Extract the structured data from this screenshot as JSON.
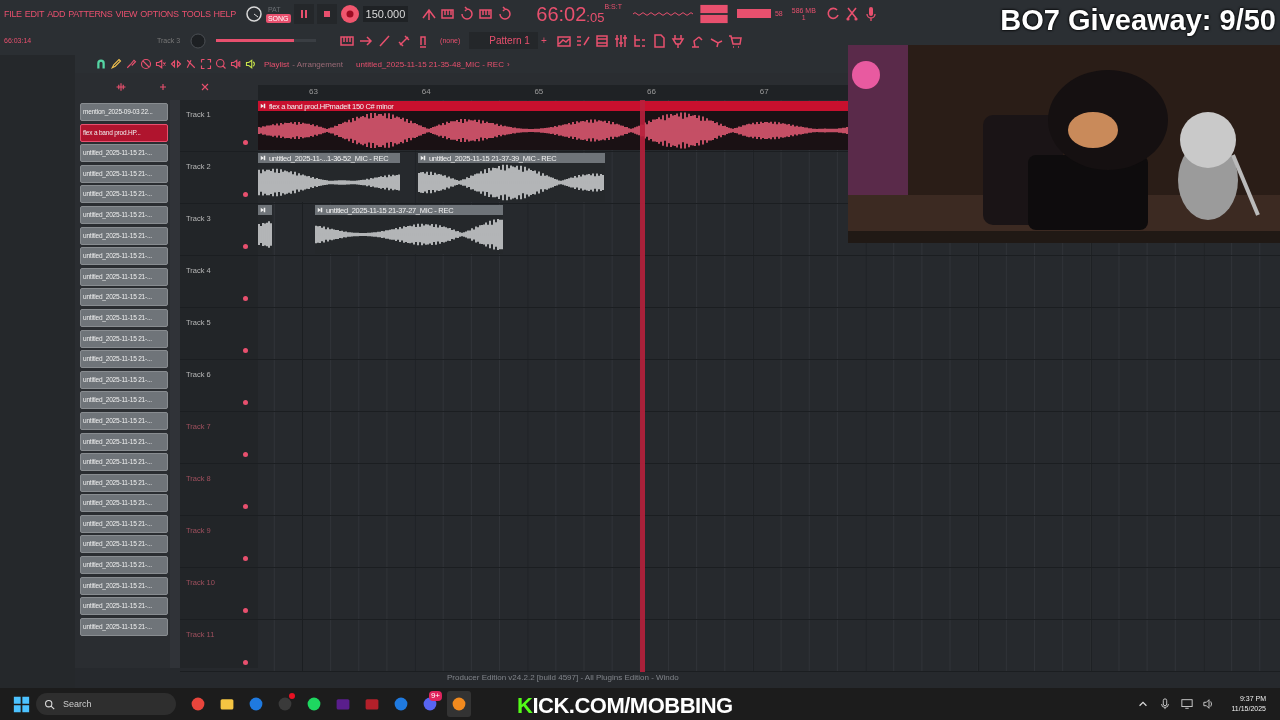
{
  "menu": [
    "FILE",
    "EDIT",
    "ADD",
    "PATTERNS",
    "VIEW",
    "OPTIONS",
    "TOOLS",
    "HELP"
  ],
  "transport": {
    "modes": [
      {
        "label": "PAT",
        "selected": false
      },
      {
        "label": "SONG",
        "selected": true
      }
    ],
    "record_on": true,
    "tempo": "150.000"
  },
  "time": {
    "main": "66:02",
    "sub": ":05",
    "unit": "B:S:T"
  },
  "monitor": {
    "cpu": "58",
    "memory": "586 MB",
    "polyphony": "1"
  },
  "hint_bar": {
    "position": "66:03:14",
    "target": "Track 3"
  },
  "main_volume": {
    "level": 0.78
  },
  "pattern": {
    "channel_filter": "(none)",
    "name": "Pattern 1",
    "add": "+"
  },
  "playlist": {
    "title": "Playlist",
    "view": "- Arrangement",
    "clip_name": "untitled_2025-11-15 21-35-48_MIC - REC",
    "arrow": "›"
  },
  "ruler": {
    "bars": [
      "63",
      "64",
      "65",
      "66",
      "67"
    ]
  },
  "clip_list": [
    {
      "name": "mention_2025-09-03 22...",
      "selected": false
    },
    {
      "name": "flex a band prod.HP...",
      "selected": true
    },
    {
      "name": "untitled_2025-11-15 21-...",
      "selected": false
    },
    {
      "name": "untitled_2025-11-15 21-...",
      "selected": false
    },
    {
      "name": "untitled_2025-11-15 21-...",
      "selected": false
    },
    {
      "name": "untitled_2025-11-15 21-...",
      "selected": false
    },
    {
      "name": "untitled_2025-11-15 21-...",
      "selected": false
    },
    {
      "name": "untitled_2025-11-15 21-...",
      "selected": false
    },
    {
      "name": "untitled_2025-11-15 21-...",
      "selected": false
    },
    {
      "name": "untitled_2025-11-15 21-...",
      "selected": false
    },
    {
      "name": "untitled_2025-11-15 21-...",
      "selected": false
    },
    {
      "name": "untitled_2025-11-15 21-...",
      "selected": false
    },
    {
      "name": "untitled_2025-11-15 21-...",
      "selected": false
    },
    {
      "name": "untitled_2025-11-15 21-...",
      "selected": false
    },
    {
      "name": "untitled_2025-11-15 21-...",
      "selected": false
    },
    {
      "name": "untitled_2025-11-15 21-...",
      "selected": false
    },
    {
      "name": "untitled_2025-11-15 21-...",
      "selected": false
    },
    {
      "name": "untitled_2025-11-15 21-...",
      "selected": false
    },
    {
      "name": "untitled_2025-11-15 21-...",
      "selected": false
    },
    {
      "name": "untitled_2025-11-15 21-...",
      "selected": false
    },
    {
      "name": "untitled_2025-11-15 21-...",
      "selected": false
    },
    {
      "name": "untitled_2025-11-15 21-...",
      "selected": false
    },
    {
      "name": "untitled_2025-11-15 21-...",
      "selected": false
    },
    {
      "name": "untitled_2025-11-15 21-...",
      "selected": false
    },
    {
      "name": "untitled_2025-11-15 21-...",
      "selected": false
    },
    {
      "name": "untitled_2025-11-15 21-...",
      "selected": false
    }
  ],
  "tracks": [
    {
      "name": "Track 1",
      "active": true,
      "clips": [
        {
          "name": "flex a band prod.HPmadeit 150 C# minor",
          "color": "#c8102e"
        }
      ]
    },
    {
      "name": "Track 2",
      "active": true,
      "clips": [
        {
          "name": "untitled_2025-11-...1-36-52_MIC - REC",
          "color": "#6f7479"
        },
        {
          "name": "untitled_2025-11-15 21-37-39_MIC - REC",
          "color": "#6f7479"
        }
      ]
    },
    {
      "name": "Track 3",
      "active": true,
      "clips": [
        {
          "color": "#6f7479"
        },
        {
          "name": "untitled_2025-11-15 21-37-27_MIC - REC",
          "color": "#6f7479"
        }
      ]
    },
    {
      "name": "Track 4",
      "active": true
    },
    {
      "name": "Track 5",
      "active": true
    },
    {
      "name": "Track 6",
      "active": true
    },
    {
      "name": "Track 7",
      "active": false
    },
    {
      "name": "Track 8",
      "active": false
    },
    {
      "name": "Track 9",
      "active": false
    },
    {
      "name": "Track 10",
      "active": false
    },
    {
      "name": "Track 11",
      "active": false
    }
  ],
  "status": "Producer Edition v24.2.2 [build 4597] - All Plugins Edition - Windo",
  "overlay": {
    "giveaway": "BO7 Giveaway: 9/50",
    "stream_accent": "K",
    "stream_rest": "ICK.COM/MOBBING"
  },
  "taskbar": {
    "search": "Search",
    "apps": [
      {
        "kind": "chrome",
        "active": false,
        "alert": false
      },
      {
        "kind": "folder",
        "active": false,
        "alert": false
      },
      {
        "kind": "blue",
        "active": false,
        "alert": false
      },
      {
        "kind": "obs",
        "active": false,
        "alert": true
      },
      {
        "kind": "spotify",
        "active": false,
        "alert": false
      },
      {
        "kind": "purple",
        "active": false,
        "alert": false
      },
      {
        "kind": "mixer",
        "active": false,
        "alert": false
      },
      {
        "kind": "blue",
        "active": false,
        "alert": false
      },
      {
        "kind": "discord",
        "active": false,
        "alert": false,
        "badge": "9+"
      },
      {
        "kind": "fruit",
        "active": true,
        "alert": false
      }
    ],
    "clock": {
      "time": "9:37 PM",
      "date": "11/15/2025"
    }
  }
}
